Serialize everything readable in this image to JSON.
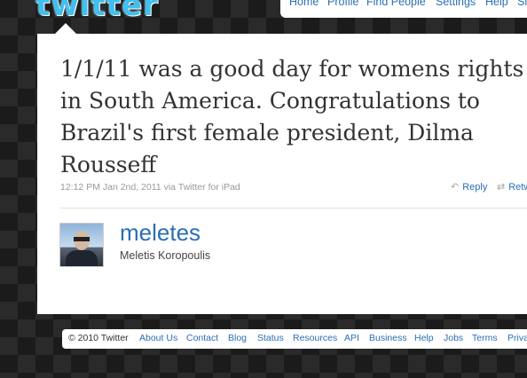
{
  "header": {
    "logo_text": "twitter",
    "nav": [
      {
        "label": "Home"
      },
      {
        "label": "Profile"
      },
      {
        "label": "Find People"
      },
      {
        "label": "Settings"
      },
      {
        "label": "Help"
      },
      {
        "label": "Si"
      }
    ]
  },
  "tweet": {
    "text": "1/1/11 was a good day for womens rights in South America. Congratulations to Brazil's first female president, Dilma Rousseff",
    "timestamp": "12:12 PM Jan 2nd, 2011",
    "via_prefix": "via",
    "via_app": "Twitter for iPad",
    "actions": {
      "reply": "Reply",
      "retweet": "Retw"
    }
  },
  "user": {
    "screen_name": "meletes",
    "full_name": "Meletis Koropoulis"
  },
  "footer": {
    "copyright": "© 2010 Twitter",
    "links": [
      {
        "label": "About Us"
      },
      {
        "label": "Contact"
      },
      {
        "label": "Blog"
      },
      {
        "label": "Status"
      },
      {
        "label": "Resources"
      },
      {
        "label": "API"
      },
      {
        "label": "Business"
      },
      {
        "label": "Help"
      },
      {
        "label": "Jobs"
      },
      {
        "label": "Terms"
      },
      {
        "label": "Priva"
      }
    ]
  },
  "colors": {
    "link": "#2a6fb3",
    "logo": "#3fc0f0",
    "background": "#1b1b1b"
  }
}
